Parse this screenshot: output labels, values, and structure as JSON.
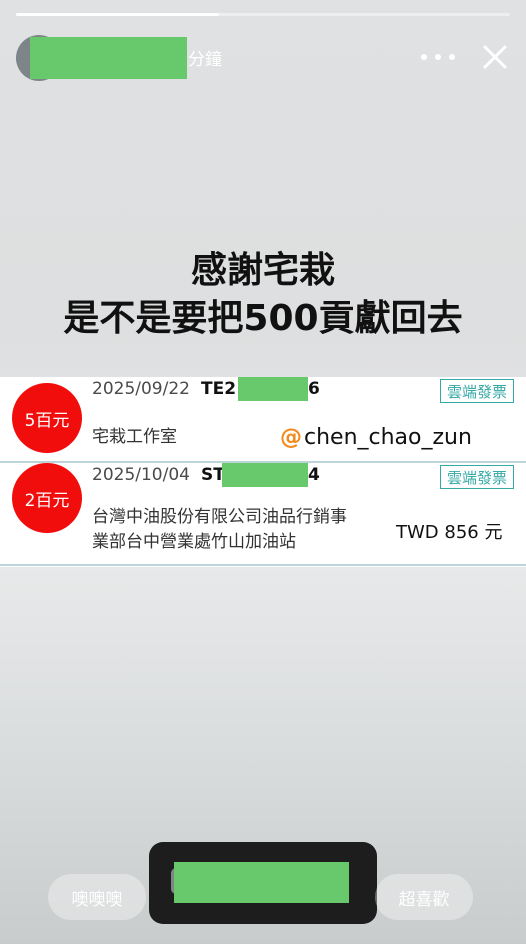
{
  "story": {
    "progress": 0.41,
    "time_ago": "分鐘",
    "headline_line1": "感謝宅栽",
    "headline_line2": "是不是要把500貢獻回去"
  },
  "invoices": [
    {
      "amount": "5百元",
      "date": "2025/09/22",
      "code_prefix": "TE2",
      "code_suffix": "6",
      "badge": "雲端發票",
      "merchant": "宅栽工作室"
    },
    {
      "amount": "2百元",
      "date": "2025/10/04",
      "code_prefix": "ST",
      "code_suffix": "4",
      "badge": "雲端發票",
      "merchant_line1": "台灣中油股份有限公司油品行銷事",
      "merchant_line2": "業部台中營業處竹山加油站",
      "total": "TWD  856 元"
    }
  ],
  "watermark": {
    "handle": "chen_chao_zun",
    "icon": "at-icon"
  },
  "reactions": {
    "left_label": "噢噢噢",
    "right_label": "超喜歡"
  },
  "colors": {
    "amount_red": "#f20d0d",
    "badge_teal": "#35a9a6",
    "redaction_green": "#67c96c"
  }
}
